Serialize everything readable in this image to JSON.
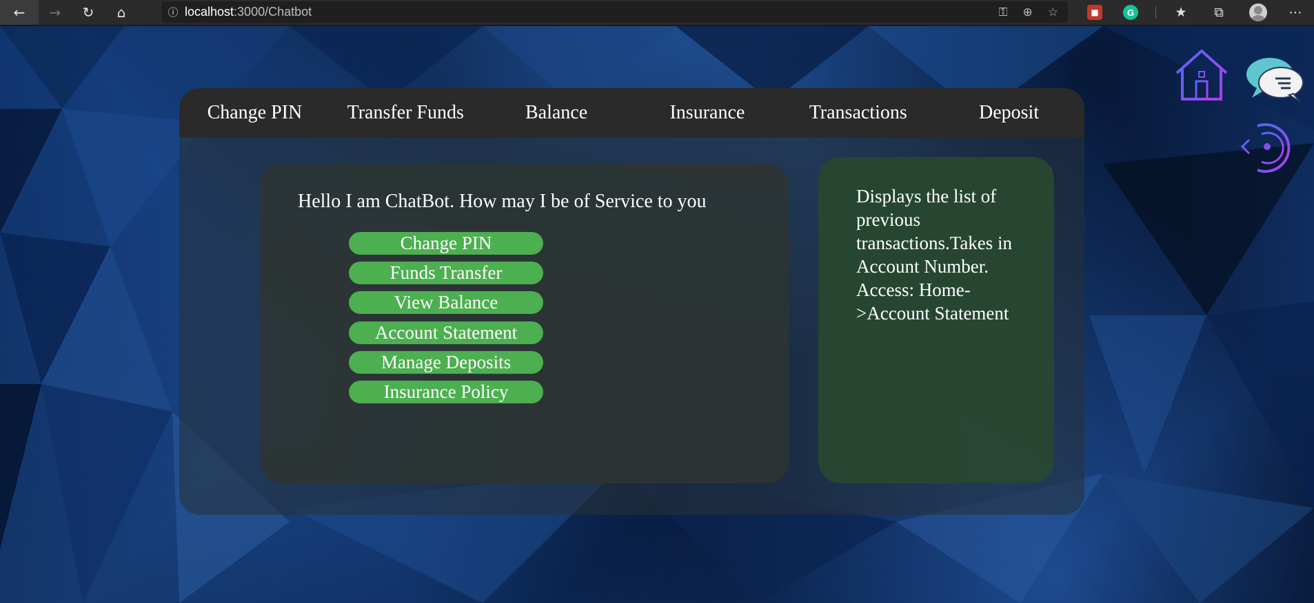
{
  "browser": {
    "url_host": "localhost",
    "url_path": ":3000/Chatbot",
    "info_icon": "info-icon",
    "extension_a_icon": "extension-icon",
    "extension_g_letter": "G"
  },
  "navbar": {
    "items": [
      "Change PIN",
      "Transfer Funds",
      "Balance",
      "Insurance",
      "Transactions",
      "Deposit"
    ]
  },
  "chat": {
    "greeting": "Hello I am ChatBot. How may I be of Service to you",
    "options": [
      "Change PIN",
      "Funds Transfer",
      "View Balance",
      "Account Statement",
      "Manage Deposits",
      "Insurance Policy"
    ]
  },
  "description": {
    "text": "Displays the list of previous transactions.Takes in Account Number. Access: Home->Account Statement"
  },
  "side_icons": [
    "home-icon",
    "chat-icon",
    "logout-icon"
  ],
  "colors": {
    "accent_green": "#4caf50",
    "navbar_bg": "#2a2a2a",
    "icon_purple": "#7b3cf0"
  }
}
